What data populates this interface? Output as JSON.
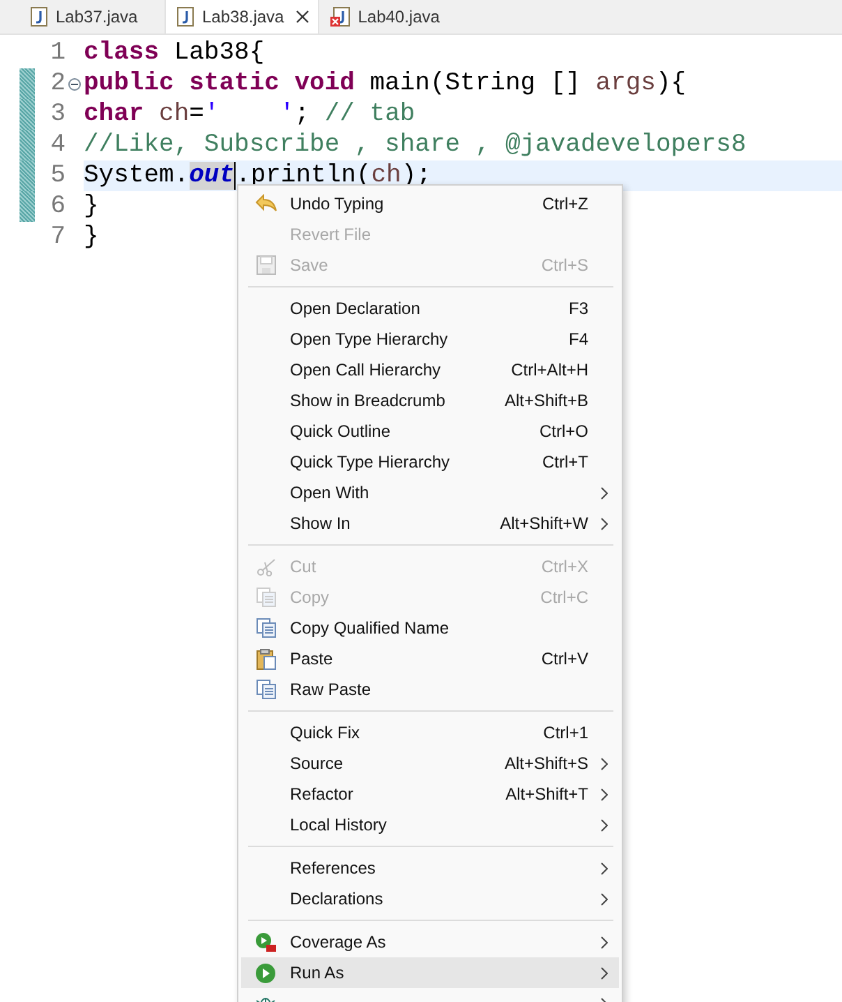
{
  "tabs": [
    {
      "label": "Lab37.java",
      "selected": false,
      "kind": "java",
      "closable": false
    },
    {
      "label": "Lab38.java",
      "selected": true,
      "kind": "java",
      "closable": true
    },
    {
      "label": "Lab40.java",
      "selected": false,
      "kind": "java-error",
      "closable": false
    }
  ],
  "editor": {
    "lines": [
      {
        "number": "1",
        "changed": false,
        "current": false,
        "foldable": false,
        "tokens": [
          {
            "kind": "keyword",
            "text": "class"
          },
          {
            "kind": "plain",
            "text": " Lab38{"
          }
        ]
      },
      {
        "number": "2",
        "changed": true,
        "current": false,
        "foldable": true,
        "tokens": [
          {
            "kind": "keyword",
            "text": "public static void"
          },
          {
            "kind": "plain",
            "text": " main(String [] "
          },
          {
            "kind": "variable",
            "text": "args"
          },
          {
            "kind": "plain",
            "text": "){"
          }
        ]
      },
      {
        "number": "3",
        "changed": true,
        "current": false,
        "foldable": false,
        "tokens": [
          {
            "kind": "keyword",
            "text": "char"
          },
          {
            "kind": "variable",
            "text": " ch"
          },
          {
            "kind": "plain",
            "text": "="
          },
          {
            "kind": "string",
            "text": "'    '"
          },
          {
            "kind": "plain",
            "text": "; "
          },
          {
            "kind": "comment",
            "text": "// tab"
          }
        ]
      },
      {
        "number": "4",
        "changed": true,
        "current": false,
        "foldable": false,
        "tokens": [
          {
            "kind": "comment",
            "text": "//Like, Subscribe , share , @javadevelopers8"
          }
        ]
      },
      {
        "number": "5",
        "changed": true,
        "current": true,
        "foldable": false,
        "tokens": [
          {
            "kind": "plain",
            "text": "System."
          },
          {
            "kind": "field",
            "text": "out",
            "selected": true
          },
          {
            "kind": "plain",
            "text": ".println("
          },
          {
            "kind": "variable",
            "text": "ch"
          },
          {
            "kind": "plain",
            "text": ");"
          }
        ]
      },
      {
        "number": "6",
        "changed": true,
        "current": false,
        "foldable": false,
        "tokens": [
          {
            "kind": "plain",
            "text": "}"
          }
        ]
      },
      {
        "number": "7",
        "changed": false,
        "current": false,
        "foldable": false,
        "tokens": [
          {
            "kind": "plain",
            "text": "}"
          }
        ]
      }
    ]
  },
  "context_menu": {
    "groups": [
      [
        {
          "label": "Undo Typing",
          "shortcut": "Ctrl+Z",
          "kind": "undo",
          "disabled": false,
          "submenu": false,
          "selected": false
        },
        {
          "label": "Revert File",
          "disabled": true,
          "submenu": false,
          "selected": false
        },
        {
          "label": "Save",
          "shortcut": "Ctrl+S",
          "kind": "save",
          "disabled": true,
          "submenu": false,
          "selected": false
        }
      ],
      [
        {
          "label": "Open Declaration",
          "shortcut": "F3",
          "disabled": false,
          "submenu": false,
          "selected": false
        },
        {
          "label": "Open Type Hierarchy",
          "shortcut": "F4",
          "disabled": false,
          "submenu": false,
          "selected": false
        },
        {
          "label": "Open Call Hierarchy",
          "shortcut": "Ctrl+Alt+H",
          "disabled": false,
          "submenu": false,
          "selected": false
        },
        {
          "label": "Show in Breadcrumb",
          "shortcut": "Alt+Shift+B",
          "disabled": false,
          "submenu": false,
          "selected": false
        },
        {
          "label": "Quick Outline",
          "shortcut": "Ctrl+O",
          "disabled": false,
          "submenu": false,
          "selected": false
        },
        {
          "label": "Quick Type Hierarchy",
          "shortcut": "Ctrl+T",
          "disabled": false,
          "submenu": false,
          "selected": false
        },
        {
          "label": "Open With",
          "disabled": false,
          "submenu": true,
          "selected": false
        },
        {
          "label": "Show In",
          "shortcut": "Alt+Shift+W",
          "disabled": false,
          "submenu": true,
          "selected": false
        }
      ],
      [
        {
          "label": "Cut",
          "shortcut": "Ctrl+X",
          "kind": "cut",
          "disabled": true,
          "submenu": false,
          "selected": false
        },
        {
          "label": "Copy",
          "shortcut": "Ctrl+C",
          "kind": "copy",
          "disabled": true,
          "submenu": false,
          "selected": false
        },
        {
          "label": "Copy Qualified Name",
          "kind": "copy",
          "disabled": false,
          "submenu": false,
          "selected": false
        },
        {
          "label": "Paste",
          "shortcut": "Ctrl+V",
          "kind": "paste",
          "disabled": false,
          "submenu": false,
          "selected": false
        },
        {
          "label": "Raw Paste",
          "kind": "copy",
          "disabled": false,
          "submenu": false,
          "selected": false
        }
      ],
      [
        {
          "label": "Quick Fix",
          "shortcut": "Ctrl+1",
          "disabled": false,
          "submenu": false,
          "selected": false
        },
        {
          "label": "Source",
          "shortcut": "Alt+Shift+S",
          "disabled": false,
          "submenu": true,
          "selected": false
        },
        {
          "label": "Refactor",
          "shortcut": "Alt+Shift+T",
          "disabled": false,
          "submenu": true,
          "selected": false
        },
        {
          "label": "Local History",
          "disabled": false,
          "submenu": true,
          "selected": false
        }
      ],
      [
        {
          "label": "References",
          "disabled": false,
          "submenu": true,
          "selected": false
        },
        {
          "label": "Declarations",
          "disabled": false,
          "submenu": true,
          "selected": false
        }
      ],
      [
        {
          "label": "Coverage As",
          "kind": "coverage",
          "disabled": false,
          "submenu": true,
          "selected": false
        },
        {
          "label": "Run As",
          "kind": "run",
          "disabled": false,
          "submenu": true,
          "selected": true
        },
        {
          "kind": "debug",
          "disabled": false,
          "submenu": true,
          "selected": false
        }
      ]
    ]
  }
}
